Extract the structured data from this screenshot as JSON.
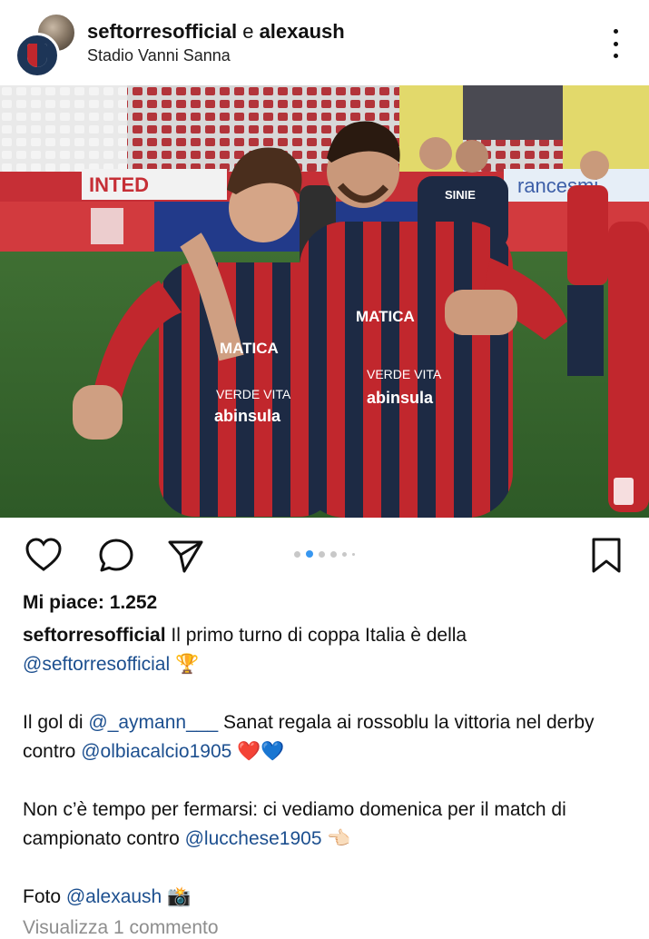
{
  "header": {
    "user1": "seftorresofficial",
    "conjunction": "e",
    "user2": "alexaush",
    "location": "Stadio Vanni Sanna"
  },
  "photo": {
    "banner_left": "INTED",
    "banner_right": "rancesmi",
    "shirt_name": "SINIE",
    "sponsor_1": "MATICA",
    "sponsor_2": "VERDE VITA",
    "sponsor_3": "abinsula"
  },
  "carousel": {
    "total_dots": 6,
    "active_index": 1
  },
  "post": {
    "likes_label": "Mi piace: 1.252",
    "caption_user": "seftorresofficial",
    "line1_text": " Il primo turno di coppa Italia è della",
    "line2_mention": "@seftorresofficial",
    "line2_emoji": " 🏆",
    "para2_a": "Il gol di ",
    "para2_mention1": "@_aymann___",
    "para2_b": " Sanat regala ai rossoblu la vittoria nel derby contro ",
    "para2_mention2": "@olbiacalcio1905",
    "para2_emoji": " ❤️💙",
    "para3_a": "Non c’è tempo per fermarsi: ci vediamo domenica per il match di campionato contro ",
    "para3_mention": "@lucchese1905",
    "para3_emoji": " 👈🏻",
    "para4_a": "Foto ",
    "para4_mention": "@alexaush",
    "para4_emoji": " 📸",
    "comments_link": "Visualizza 1 commento"
  },
  "colors": {
    "mention": "#1c4f8f",
    "carousel_active": "#3897f0",
    "kit_red": "#c1272d",
    "kit_navy": "#1d2a44"
  }
}
